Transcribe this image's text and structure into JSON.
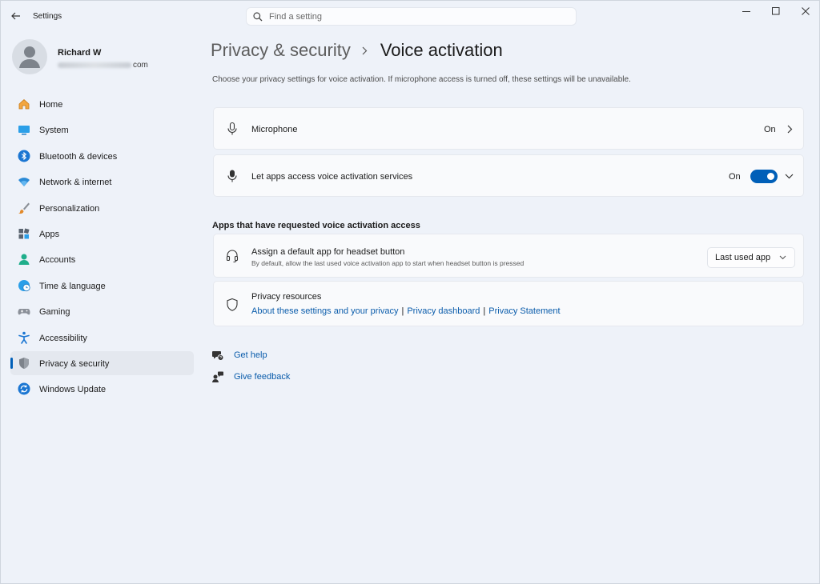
{
  "window": {
    "app_title": "Settings"
  },
  "search": {
    "placeholder": "Find a setting"
  },
  "profile": {
    "name": "Richard W",
    "email_visible_suffix": "com"
  },
  "sidebar": {
    "items": [
      {
        "label": "Home",
        "icon": "home-icon"
      },
      {
        "label": "System",
        "icon": "system-icon"
      },
      {
        "label": "Bluetooth & devices",
        "icon": "bluetooth-icon"
      },
      {
        "label": "Network & internet",
        "icon": "wifi-icon"
      },
      {
        "label": "Personalization",
        "icon": "brush-icon"
      },
      {
        "label": "Apps",
        "icon": "apps-icon"
      },
      {
        "label": "Accounts",
        "icon": "accounts-icon"
      },
      {
        "label": "Time & language",
        "icon": "time-language-icon"
      },
      {
        "label": "Gaming",
        "icon": "gaming-icon"
      },
      {
        "label": "Accessibility",
        "icon": "accessibility-icon"
      },
      {
        "label": "Privacy & security",
        "icon": "shield-icon",
        "active": true
      },
      {
        "label": "Windows Update",
        "icon": "update-icon"
      }
    ]
  },
  "breadcrumb": {
    "parent": "Privacy & security",
    "current": "Voice activation"
  },
  "description": "Choose your privacy settings for voice activation. If microphone access is turned off, these settings will be unavailable.",
  "microphone": {
    "title": "Microphone",
    "value": "On"
  },
  "voice_access": {
    "title": "Let apps access voice activation services",
    "state_label": "On",
    "enabled": true
  },
  "apps_section": {
    "heading": "Apps that have requested voice activation access"
  },
  "headset": {
    "title": "Assign a default app for headset button",
    "subtitle": "By default, allow the last used voice activation app to start when headset button is pressed",
    "selected": "Last used app"
  },
  "privacy_resources": {
    "title": "Privacy resources",
    "links": [
      "About these settings and your privacy",
      "Privacy dashboard",
      "Privacy Statement"
    ],
    "separator": "|"
  },
  "help": {
    "get_help": "Get help",
    "give_feedback": "Give feedback"
  },
  "colors": {
    "accent": "#005fb8",
    "link": "#0a5cab",
    "background": "#eef2f9",
    "card": "#f9fafc"
  }
}
